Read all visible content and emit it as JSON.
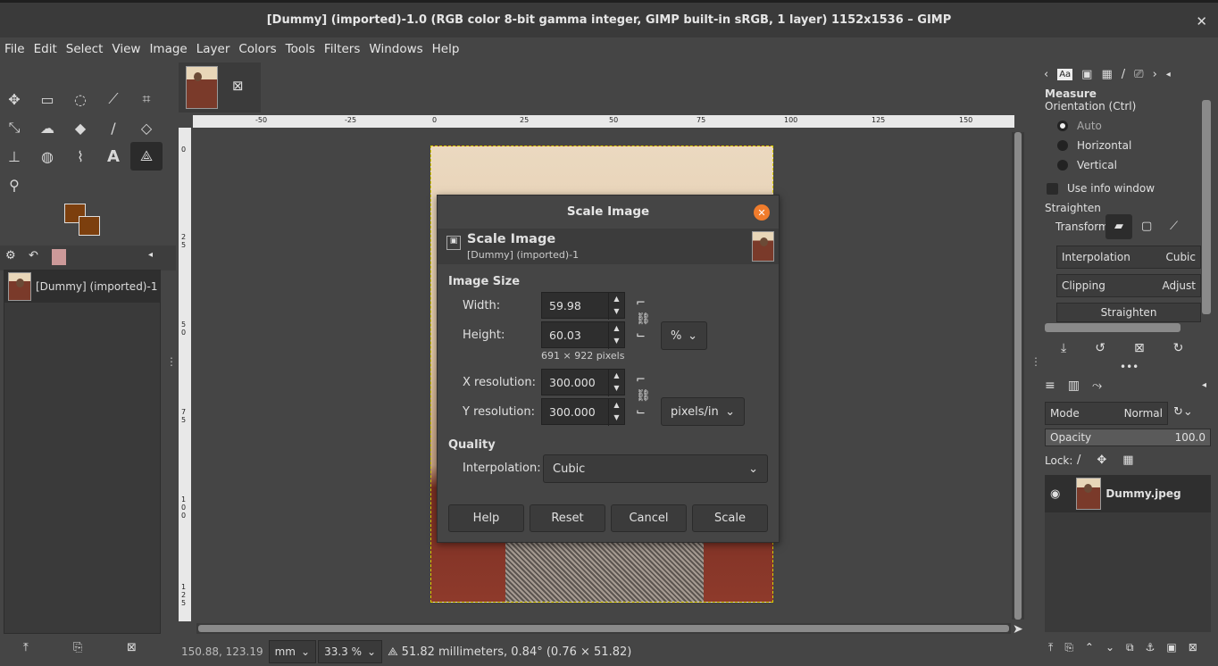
{
  "window": {
    "title": "[Dummy] (imported)-1.0 (RGB color 8-bit gamma integer, GIMP built-in sRGB, 1 layer) 1152x1536 – GIMP",
    "close": "✕"
  },
  "menu": [
    "File",
    "Edit",
    "Select",
    "View",
    "Image",
    "Layer",
    "Colors",
    "Tools",
    "Filters",
    "Windows",
    "Help"
  ],
  "images_panel": {
    "item": "[Dummy] (imported)-1"
  },
  "ruler": {
    "top_ticks": [
      "-50",
      "-25",
      "0",
      "25",
      "50",
      "75",
      "100",
      "125",
      "150"
    ],
    "left_ticks": [
      "0",
      "2\n5",
      "5\n0",
      "7\n5",
      "1\n0\n0",
      "1\n2\n5"
    ]
  },
  "status": {
    "coords": "150.88, 123.19",
    "unit": "mm",
    "zoom": "33.3 %",
    "message": "51.82 millimeters, 0.84° (0.76 × 51.82)"
  },
  "tool_options": {
    "title": "Measure",
    "orientation_label": "Orientation  (Ctrl)",
    "orientation": [
      "Auto",
      "Horizontal",
      "Vertical"
    ],
    "use_info": "Use info window",
    "straighten_label": "Straighten",
    "transform_label": "Transform:",
    "interpolation": {
      "label": "Interpolation",
      "value": "Cubic"
    },
    "clipping": {
      "label": "Clipping",
      "value": "Adjust"
    },
    "straighten_button": "Straighten"
  },
  "layers": {
    "mode_label": "Mode",
    "mode_value": "Normal",
    "opacity_label": "Opacity",
    "opacity_value": "100.0",
    "lock_label": "Lock:",
    "layer_name": "Dummy.jpeg"
  },
  "dialog": {
    "title": "Scale Image",
    "header_title": "Scale Image",
    "header_sub": "[Dummy] (imported)-1",
    "image_size": "Image Size",
    "width_label": "Width:",
    "width_value": "59.98",
    "height_label": "Height:",
    "height_value": "60.03",
    "size_unit": "%",
    "pixels_info": "691 × 922 pixels",
    "xres_label": "X resolution:",
    "xres_value": "300.000",
    "yres_label": "Y resolution:",
    "yres_value": "300.000",
    "res_unit": "pixels/in",
    "quality": "Quality",
    "interp_label": "Interpolation:",
    "interp_value": "Cubic",
    "buttons": {
      "help": "Help",
      "reset": "Reset",
      "cancel": "Cancel",
      "scale": "Scale"
    }
  }
}
